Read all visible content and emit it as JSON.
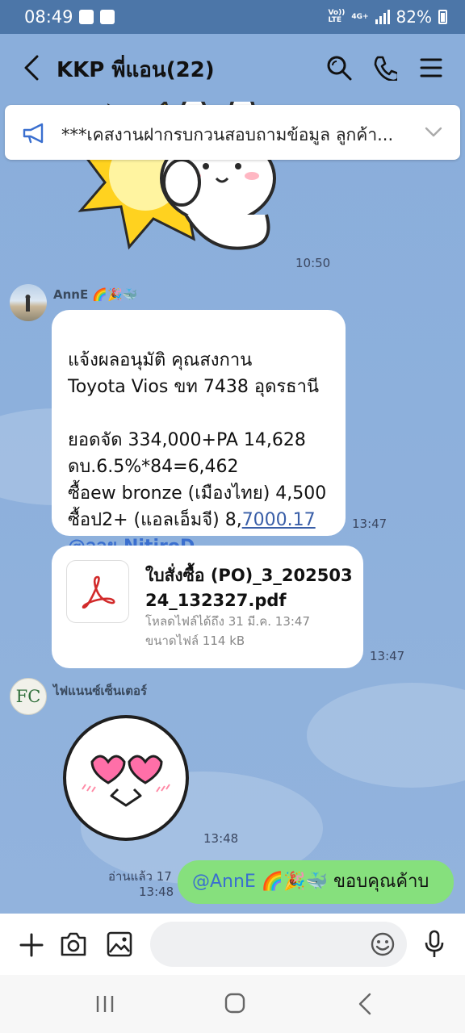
{
  "status_bar": {
    "time": "08:49",
    "network_top": "Vo))",
    "network_bottom": "LTE",
    "data_type": "4G+",
    "battery": "82%"
  },
  "header": {
    "title": "KKP พี่แอน(22)"
  },
  "announcement": {
    "text": "***เคสงานฝากรบกวนสอบถามข้อมูล ลูกค้า..."
  },
  "messages": {
    "sticker1": {
      "time": "10:50"
    },
    "anne_text": {
      "sender": "AnnE 🌈🎉🐳",
      "line1": "แจ้งผลอนุมัติ คุณสงกาน",
      "line2": "Toyota Vios ขท 7438 อุดรธานี",
      "line3": "ยอดจัด 334,000+PA 14,628",
      "line4": "ดบ.6.5%*84=6,462",
      "line5": "ซื้อew bronze (เมืองไทย) 4,500",
      "line6_prefix": "ซื้อป2+ (แอลเอ็มจี) 8,",
      "line6_link": "7000.17",
      "mention": "@ออย NitiroD",
      "time": "13:47"
    },
    "file": {
      "name_line1": "ใบสั่งซื้อ (PO)_3_202503",
      "name_line2": "24_132327.pdf",
      "expiry": "โหลดไฟล์ได้ถึง 31 มี.ค. 13:47",
      "size": "ขนาดไฟล์ 114 kB",
      "time": "13:47"
    },
    "finance_sticker": {
      "sender": "ไฟแนนซ์เซ็นเตอร์",
      "avatar_text": "FC",
      "time": "13:48"
    },
    "my_reply": {
      "read_status": "อ่านแล้ว 17",
      "time": "13:48",
      "mention": "@AnnE 🌈🎉🐳",
      "text": " ขอบคุณค้าบ"
    }
  },
  "input": {
    "placeholder": ""
  },
  "colors": {
    "chat_bg": "#8aaedb",
    "status_bar": "#4c76a8",
    "my_bubble": "#86e07d",
    "link": "#3a5fa8",
    "mention": "#3a6fcf"
  }
}
